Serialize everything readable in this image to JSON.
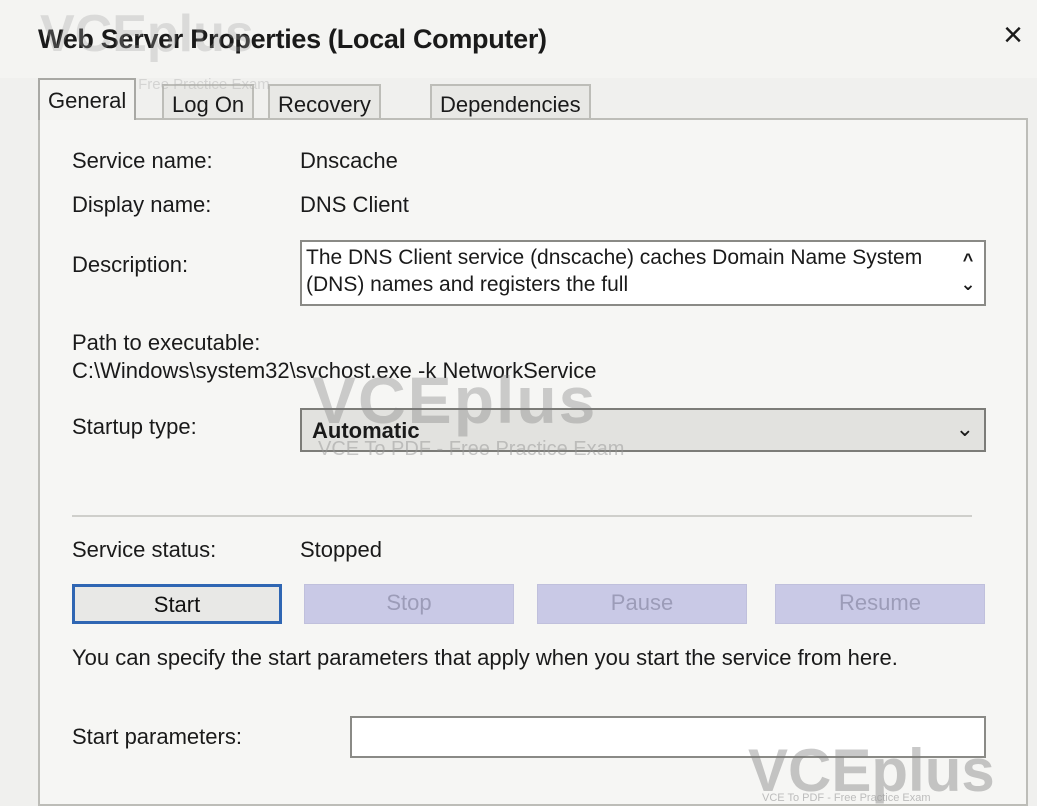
{
  "window": {
    "title": "Web Server Properties (Local Computer)",
    "close_glyph": "×"
  },
  "tabs": [
    {
      "label": "General",
      "active": true
    },
    {
      "label": "Log On",
      "active": false
    },
    {
      "label": "Recovery",
      "active": false
    },
    {
      "label": "Dependencies",
      "active": false
    }
  ],
  "general": {
    "service_name_label": "Service name:",
    "service_name": "Dnscache",
    "display_name_label": "Display name:",
    "display_name": "DNS Client",
    "description_label": "Description:",
    "description": "The DNS Client service (dnscache) caches Domain Name System (DNS) names and registers the full",
    "path_label": "Path to executable:",
    "path": "C:\\Windows\\system32\\svchost.exe -k NetworkService",
    "startup_type_label": "Startup type:",
    "startup_type": "Automatic",
    "service_status_label": "Service status:",
    "service_status": "Stopped",
    "buttons": {
      "start": "Start",
      "stop": "Stop",
      "pause": "Pause",
      "resume": "Resume"
    },
    "help_text": "You can specify the start parameters that apply when you start the service from here.",
    "start_parameters_label": "Start parameters:",
    "start_parameters_value": ""
  },
  "watermarks": {
    "brand": "VCEplus",
    "tagline": "VCE To PDF - Free Practice Exam"
  },
  "icons": {
    "close": "close-icon",
    "scroll_up": "chevron-up-icon",
    "scroll_down": "chevron-down-icon",
    "dropdown": "chevron-down-icon"
  },
  "colors": {
    "focus_border": "#2f66b3",
    "disabled_button": "#c9c9e6"
  }
}
